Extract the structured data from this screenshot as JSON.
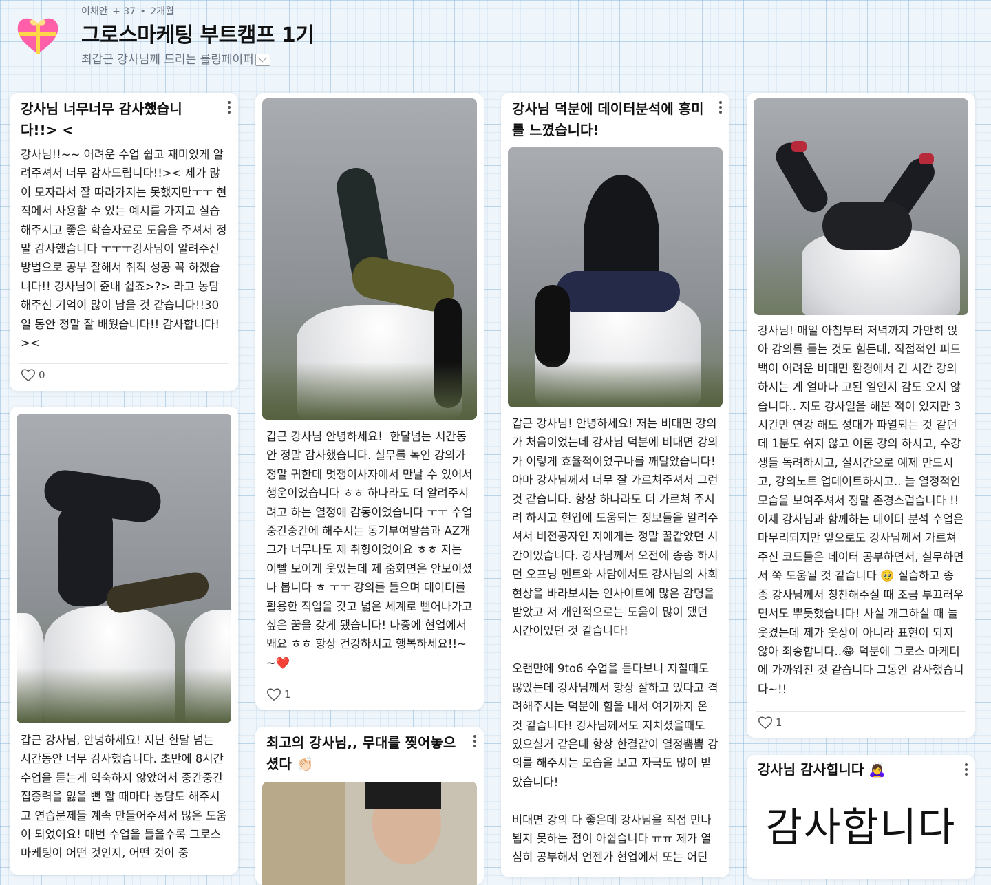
{
  "header": {
    "author": "이채안",
    "extra_count": "+ 37",
    "time_ago": "2개월",
    "title": "그로스마케팅 부트캠프 1기",
    "subtitle": "최갑근 강사님께 드리는 롤링페이퍼"
  },
  "cards": [
    {
      "title": "강사님 너무너무 감사했습니다!!> <",
      "body": "강사님!!~~ 어려운 수업 쉽고 재미있게 알려주셔서 너무 감사드립니다!!>< 제가 많이 모자라서 잘 따라가지는 못했지만ㅜㅜ 현직에서 사용할 수 있는 예시를 가지고 실습해주시고 좋은 학습자료로 도움을 주셔서 정말 감사했습니다 ㅜㅜㅜ강사님이 알려주신 방법으로 공부 잘해서 취직 성공 꼭 하겠습니다!! 강사님이 쥰내 쉽죠>?> 라고 농담 해주신 기억이 많이 남을 것 같습니다!!30일 동안 정말 잘 배웠습니다!! 감사합니다!><",
      "likes": "0"
    },
    {
      "body": "갑근 강사님, 안녕하세요! 지난 한달 넘는 시간동안 너무 감사했습니다. 초반에 8시간 수업을 듣는게 익숙하지 않았어서 중간중간 집중력을 잃을 뻔 할 때마다 농담도 해주시고 연습문제들 계속 만들어주셔서 많은 도움이 되었어요! 매번 수업을 들을수록 그로스 마케팅이 어떤 것인지, 어떤 것이 중"
    },
    {
      "body": "갑근 강사님 안녕하세요!  한달넘는 시간동안 정말 감사했습니다. 실무를 녹인 강의가 정말 귀한데 멋쟁이사자에서 만날 수 있어서 행운이었습니다 ㅎㅎ 하나라도 더 알려주시려고 하는 열정에 감동이었습니다 ㅜㅜ 수업 중간중간에 해주시는 동기부여말씀과 AZ개그가 너무나도 제 취향이었어요 ㅎㅎ 저는 이빨 보이게 웃었는데 제 줌화면은 안보이셨나 봅니다 ㅎ ㅜㅜ 강의를 들으며 데이터를 활용한 직업을 갖고 넓은 세계로 뻗어나가고 싶은 꿈을 갖게 됐습니다! 나중에 현업에서 봬요 ㅎㅎ 항상 건강하시고 행복하세요!!~~❤️",
      "likes": "1"
    },
    {
      "title": "최고의 강사님,, 무대를 찢어놓으셨다 👏🏻"
    },
    {
      "title": "강사님 덕분에 데이터분석에 흥미를 느꼈습니다!",
      "body": "갑근 강사님! 안녕하세요! 저는 비대면 강의가 처음이었는데 강사님 덕분에 비대면 강의가 이렇게 효율적이었구나를 깨달았습니다! 아마 강사님께서 너무 잘 가르쳐주셔서 그런 것 같습니다. 항상 하나라도 더 가르쳐 주시려 하시고 현업에 도움되는 정보들을 알려주셔서 비전공자인 저에게는 정말 꿀같았던 시간이었습니다. 강사님께서 오전에 종종 하시던 오프닝 멘트와 사담에서도 강사님의 사회현상을 바라보시는 인사이트에 많은 감명을 받았고 저 개인적으로는 도움이 많이 됐던 시간이었던 것 같습니다!\n\n오랜만에 9to6 수업을 듣다보니 지칠때도 많았는데 강사님께서 항상 잘하고 있다고 격려해주시는 덕분에 힘을 내서 여기까지 온 것 같습니다! 강사님께서도 지치셨을때도 있으실거 같은데 항상 한결같이 열정뿜뿜 강의를 해주시는 모습을 보고 자극도 많이 받았습니다!\n\n비대면 강의 다 좋은데 강사님을 직접 만나뵙지 못하는 점이 아쉽습니다 ㅠㅠ 제가 열심히 공부해서 언젠가 현업에서 또는 어딘"
    },
    {
      "body": "강사님! 매일 아침부터 저녁까지 가만히 앉아 강의를 듣는 것도 힘든데, 직접적인 피드백이 어려운 비대면 환경에서 긴 시간 강의하시는 게 얼마나 고된 일인지 감도 오지 않습니다.. 저도 강사일을 해본 적이 있지만 3시간만 연강 해도 성대가 파열되는 것 같던데 1분도 쉬지 않고 이론 강의 하시고, 수강생들 독려하시고, 실시간으로 예제 만드시고, 강의노트 업데이트하시고.. 늘 열정적인 모습을 보여주셔서 정말 존경스럽습니다 !! 이제 강사님과 함께하는 데이터 분석 수업은 마무리되지만 앞으로도 강사님께서 가르쳐주신 코드들은 데이터 공부하면서, 실무하면서 쭉 도움될 것 같습니다 🥹 실습하고 종종 강사님께서 칭찬해주실 때 조금 부끄러우면서도 뿌듯했습니다! 사실 개그하실 때 늘 웃겼는데 제가 웃상이 아니라 표현이 되지 않아 죄송합니다..😂 덕분에 그로스 마케터에 가까워진 것 같습니다 그동안 감사했습니다~!!",
      "likes": "1"
    },
    {
      "title": "강사님 감사힙니다 🙇‍♀️",
      "handwriting": "감사합니다"
    }
  ]
}
